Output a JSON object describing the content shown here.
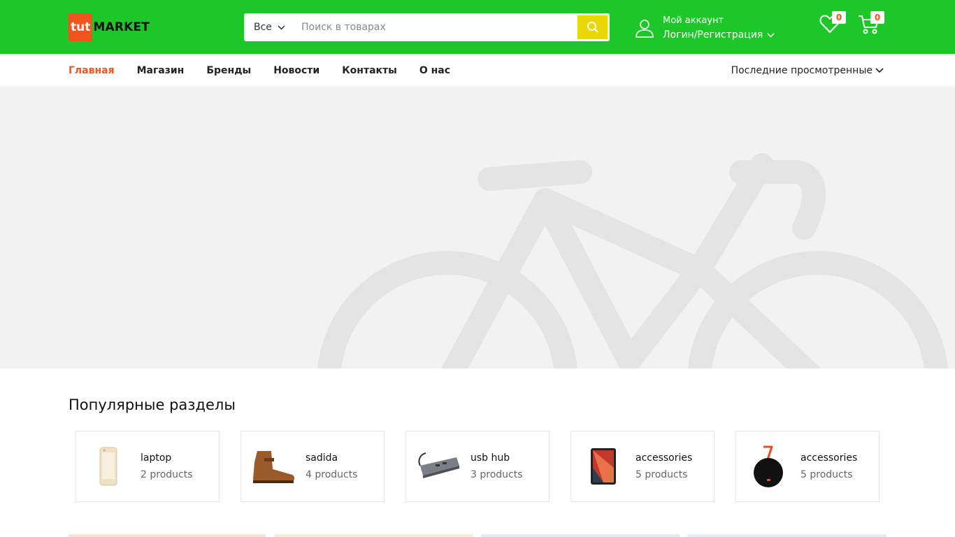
{
  "header": {
    "logo": {
      "part1": "tut",
      "part2": "MARKET"
    },
    "search": {
      "category": "Все",
      "placeholder": "Поиск в товарах"
    },
    "account": {
      "title": "Мой аккаунт",
      "link": "Логин/Регистрация"
    },
    "wishlist_count": "0",
    "cart_count": "0"
  },
  "nav": {
    "items": [
      {
        "label": "Главная",
        "active": true
      },
      {
        "label": "Магазин"
      },
      {
        "label": "Бренды"
      },
      {
        "label": "Новости"
      },
      {
        "label": "Контакты"
      },
      {
        "label": "О нас"
      }
    ],
    "recent": "Последние просмотренные"
  },
  "popular": {
    "title": "Популярные разделы",
    "categories": [
      {
        "name": "laptop",
        "count": "2 products",
        "icon": "phone-image"
      },
      {
        "name": "sadida",
        "count": "4 products",
        "icon": "boot-image"
      },
      {
        "name": "usb hub",
        "count": "3 products",
        "icon": "usb-hub-image"
      },
      {
        "name": "accessories",
        "count": "5 products",
        "icon": "tablet-image"
      },
      {
        "name": "accessories",
        "count": "5 products",
        "icon": "speaker-image"
      }
    ]
  },
  "colors": {
    "header_green": "#1ec729",
    "accent_orange": "#f2541e",
    "search_button_yellow": "#e8d800"
  }
}
